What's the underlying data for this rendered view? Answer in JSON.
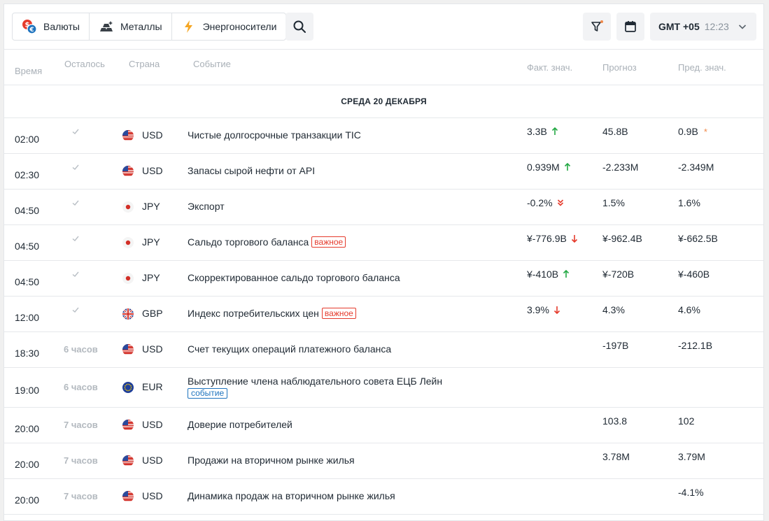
{
  "toolbar": {
    "tabs": [
      {
        "label": "Валюты",
        "icon": "currency-icon"
      },
      {
        "label": "Металлы",
        "icon": "metals-icon"
      },
      {
        "label": "Энергоносители",
        "icon": "energy-icon"
      }
    ],
    "timezone": {
      "label": "GMT +05",
      "time": "12:23"
    }
  },
  "columns": {
    "time": "Время",
    "left": "Осталось",
    "country": "Страна",
    "event": "Событие",
    "actual": "Факт. знач.",
    "forecast": "Прогноз",
    "previous": "Пред. знач."
  },
  "day_header": "СРЕДА 20 ДЕКАБРЯ",
  "badges": {
    "important": "важное",
    "event": "событие"
  },
  "colors": {
    "up": "#22a843",
    "down": "#e53b2c",
    "revised": "#f08a4b",
    "accent": "#1e73be"
  },
  "rows": [
    {
      "time": "02:00",
      "left": "",
      "done": true,
      "currency": "USD",
      "event": "Чистые долгосрочные транзакции TIC",
      "actual": "3.3B",
      "trend": "up",
      "forecast": "45.8B",
      "previous": "0.9B",
      "revised": true
    },
    {
      "time": "02:30",
      "left": "",
      "done": true,
      "currency": "USD",
      "event": "Запасы сырой нефти от API",
      "actual": "0.939M",
      "trend": "up",
      "forecast": "-2.233M",
      "previous": "-2.349M"
    },
    {
      "time": "04:50",
      "left": "",
      "done": true,
      "currency": "JPY",
      "event": "Экспорт",
      "actual": "-0.2%",
      "trend": "strong-down",
      "forecast": "1.5%",
      "previous": "1.6%"
    },
    {
      "time": "04:50",
      "left": "",
      "done": true,
      "currency": "JPY",
      "event": "Сальдо торгового баланса",
      "important": true,
      "actual": "¥-776.9B",
      "trend": "down",
      "forecast": "¥-962.4B",
      "previous": "¥-662.5B"
    },
    {
      "time": "04:50",
      "left": "",
      "done": true,
      "currency": "JPY",
      "event": "Скорректированное сальдо торгового баланса",
      "actual": "¥-410B",
      "trend": "up",
      "forecast": "¥-720B",
      "previous": "¥-460B"
    },
    {
      "time": "12:00",
      "left": "",
      "done": true,
      "currency": "GBP",
      "event": "Индекс потребительских цен",
      "important": true,
      "actual": "3.9%",
      "trend": "down",
      "forecast": "4.3%",
      "previous": "4.6%"
    },
    {
      "time": "18:30",
      "left": "6 часов",
      "currency": "USD",
      "event": "Счет текущих операций платежного баланса",
      "actual": "",
      "forecast": "-197B",
      "previous": "-212.1B"
    },
    {
      "time": "19:00",
      "left": "6 часов",
      "currency": "EUR",
      "event": "Выступление члена наблюдательного совета ЕЦБ Лейн",
      "is_event": true,
      "actual": "",
      "forecast": "",
      "previous": ""
    },
    {
      "time": "20:00",
      "left": "7 часов",
      "currency": "USD",
      "event": "Доверие потребителей",
      "actual": "",
      "forecast": "103.8",
      "previous": "102"
    },
    {
      "time": "20:00",
      "left": "7 часов",
      "currency": "USD",
      "event": "Продажи на вторичном рынке жилья",
      "actual": "",
      "forecast": "3.78M",
      "previous": "3.79M"
    },
    {
      "time": "20:00",
      "left": "7 часов",
      "currency": "USD",
      "event": "Динамика продаж на вторичном рынке жилья",
      "actual": "",
      "forecast": "",
      "previous": "-4.1%"
    }
  ]
}
